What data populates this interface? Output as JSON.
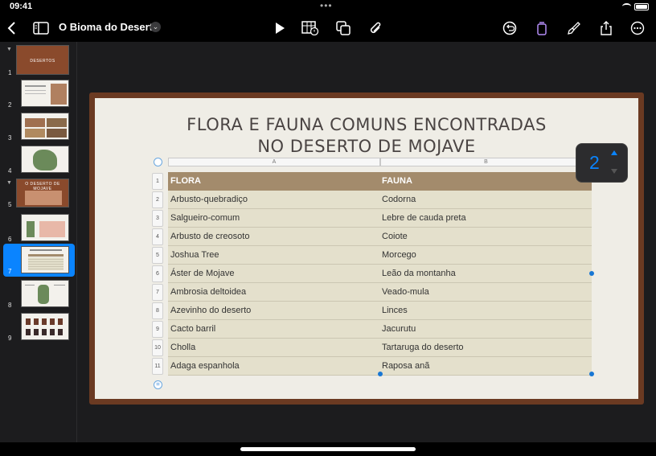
{
  "status_bar": {
    "time": "09:41"
  },
  "toolbar": {
    "document_title": "O Bioma do Deserto",
    "icons": [
      "back-icon",
      "sidebar-icon",
      "chevron-down-icon",
      "play-icon",
      "table-icon",
      "shapes-icon",
      "attachment-icon",
      "undo-icon",
      "format-icon",
      "paintbrush-icon",
      "share-icon",
      "more-icon"
    ]
  },
  "navigator": {
    "slides": [
      {
        "num": "1",
        "label": "DESERTOS"
      },
      {
        "num": "2"
      },
      {
        "num": "3"
      },
      {
        "num": "4"
      },
      {
        "num": "5",
        "label": "O DESERTO DE MOJAVE"
      },
      {
        "num": "6"
      },
      {
        "num": "7"
      },
      {
        "num": "8"
      },
      {
        "num": "9"
      }
    ],
    "selected": "7"
  },
  "slide": {
    "title_line1": "FLORA E FAUNA COMUNS ENCONTRADAS",
    "title_line2": "NO DESERTO DE MOJAVE",
    "table": {
      "column_letters": [
        "A",
        "B"
      ],
      "row_numbers": [
        "1",
        "2",
        "3",
        "4",
        "5",
        "6",
        "7",
        "8",
        "9",
        "10",
        "11"
      ],
      "headers": [
        "FLORA",
        "FAUNA"
      ],
      "rows": [
        [
          "Arbusto-quebradiço",
          "Codorna"
        ],
        [
          "Salgueiro-comum",
          "Lebre de cauda preta"
        ],
        [
          "Arbusto de creosoto",
          "Coiote"
        ],
        [
          "Joshua Tree",
          "Morcego"
        ],
        [
          "Áster de Mojave",
          "Leão da montanha"
        ],
        [
          "Ambrosia deltoidea",
          "Veado-mula"
        ],
        [
          "Azevinho do deserto",
          "Linces"
        ],
        [
          "Cacto barril",
          "Jacurutu"
        ],
        [
          "Cholla",
          "Tartaruga do deserto"
        ],
        [
          "Adaga espanhola",
          "Raposa anã"
        ]
      ]
    }
  },
  "stepper": {
    "value": "2"
  },
  "colors": {
    "accent": "#0a84ff",
    "header_row": "#a38b6c",
    "body_row": "#e4e0cc",
    "slide_border": "#6b3a22"
  }
}
